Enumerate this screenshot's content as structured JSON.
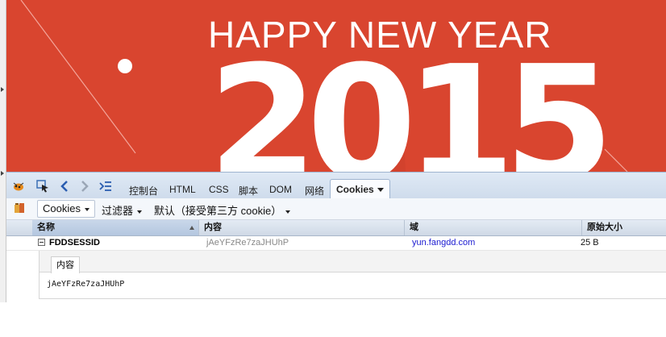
{
  "banner": {
    "headline": "HAPPY NEW YEAR",
    "year": "2015",
    "background_color": "#d9452f"
  },
  "toolbar": {
    "icons": [
      "firebug-bug-icon",
      "inspect-element-icon",
      "back-arrow-icon",
      "forward-arrow-icon",
      "console-command-icon"
    ],
    "tabs": [
      {
        "label": "控制台"
      },
      {
        "label": "HTML"
      },
      {
        "label": "CSS"
      },
      {
        "label": "脚本"
      },
      {
        "label": "DOM"
      },
      {
        "label": "网络"
      },
      {
        "label": "Cookies",
        "active": true
      }
    ]
  },
  "subbar": {
    "cookies_menu": "Cookies",
    "filter_menu": "过滤器",
    "default_menu": "默认（接受第三方 cookie）"
  },
  "table": {
    "headers": [
      "名称",
      "内容",
      "域",
      "原始大小"
    ],
    "rows": [
      {
        "name": "FDDSESSID",
        "content": "jAeYFzRe7zaJHUhP",
        "domain": "yun.fangdd.com",
        "size": "25 B"
      }
    ]
  },
  "detail": {
    "tab_label": "内容",
    "value": "jAeYFzRe7zaJHUhP"
  }
}
